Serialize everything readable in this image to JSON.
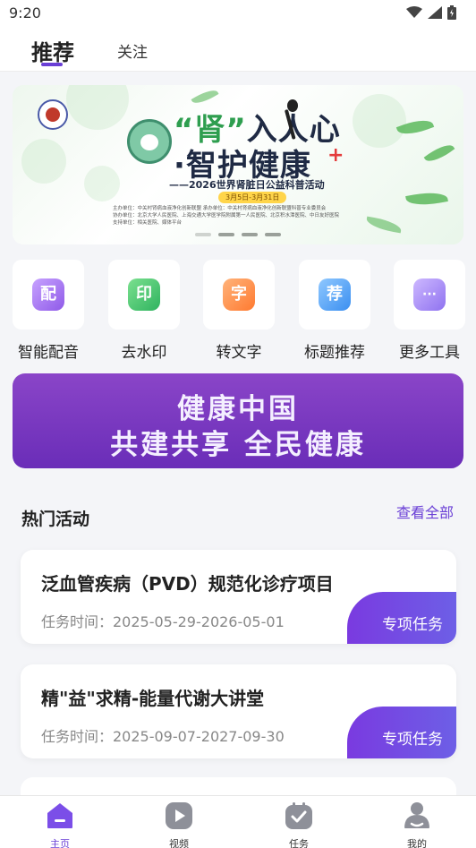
{
  "status_bar": {
    "time": "9:20"
  },
  "header": {
    "tabs": [
      {
        "label": "推荐",
        "active": true
      },
      {
        "label": "关注",
        "active": false
      }
    ],
    "accent_color": "#6a3fd6"
  },
  "banner": {
    "title_line1_part1": "“肾”",
    "title_line1_part2": "入人心",
    "title_line2": "·智护健康",
    "subtitle": "——2026世界肾脏日公益科普活动",
    "date": "3月5日-3月31日",
    "org_lines": [
      "主办单位：中关村肾病血液净化创新联盟      承办单位：中关村肾病血液净化创新联盟科普专业委员会",
      "协办单位：北京大学人民医院、上海交通大学医学院附属第一人民医院、北京积水潭医院、中日友好医院",
      "支持单位：相关医院、媒体平台"
    ],
    "page_count": 4,
    "active_page": 1
  },
  "tools": [
    {
      "label": "智能配音",
      "icon": "dubbing-icon",
      "glyph": "配",
      "color": "#9b6bf0"
    },
    {
      "label": "去水印",
      "icon": "watermark-icon",
      "glyph": "印",
      "color": "#3dbf6e"
    },
    {
      "label": "转文字",
      "icon": "text-convert-icon",
      "glyph": "字",
      "color": "#ff8a3d"
    },
    {
      "label": "标题推荐",
      "icon": "title-recommend-icon",
      "glyph": "荐",
      "color": "#4a9ff5"
    },
    {
      "label": "更多工具",
      "icon": "more-tools-icon",
      "glyph": "···",
      "color": "#a48af5"
    }
  ],
  "slogan": {
    "line1": "健康中国",
    "line2": "共建共享 全民健康"
  },
  "section": {
    "title": "热门活动",
    "more": "查看全部"
  },
  "activities": [
    {
      "title": "泛血管疾病（PVD）规范化诊疗项目",
      "time": "任务时间：2025-05-29-2026-05-01",
      "tag": "专项任务"
    },
    {
      "title": "精\"益\"求精-能量代谢大讲堂",
      "time": "任务时间：2025-09-07-2027-09-30",
      "tag": "专项任务"
    }
  ],
  "bottom_nav": [
    {
      "label": "主页",
      "icon": "home-icon",
      "active": true
    },
    {
      "label": "视频",
      "icon": "video-icon",
      "active": false
    },
    {
      "label": "任务",
      "icon": "task-icon",
      "active": false
    },
    {
      "label": "我的",
      "icon": "profile-icon",
      "active": false
    }
  ]
}
